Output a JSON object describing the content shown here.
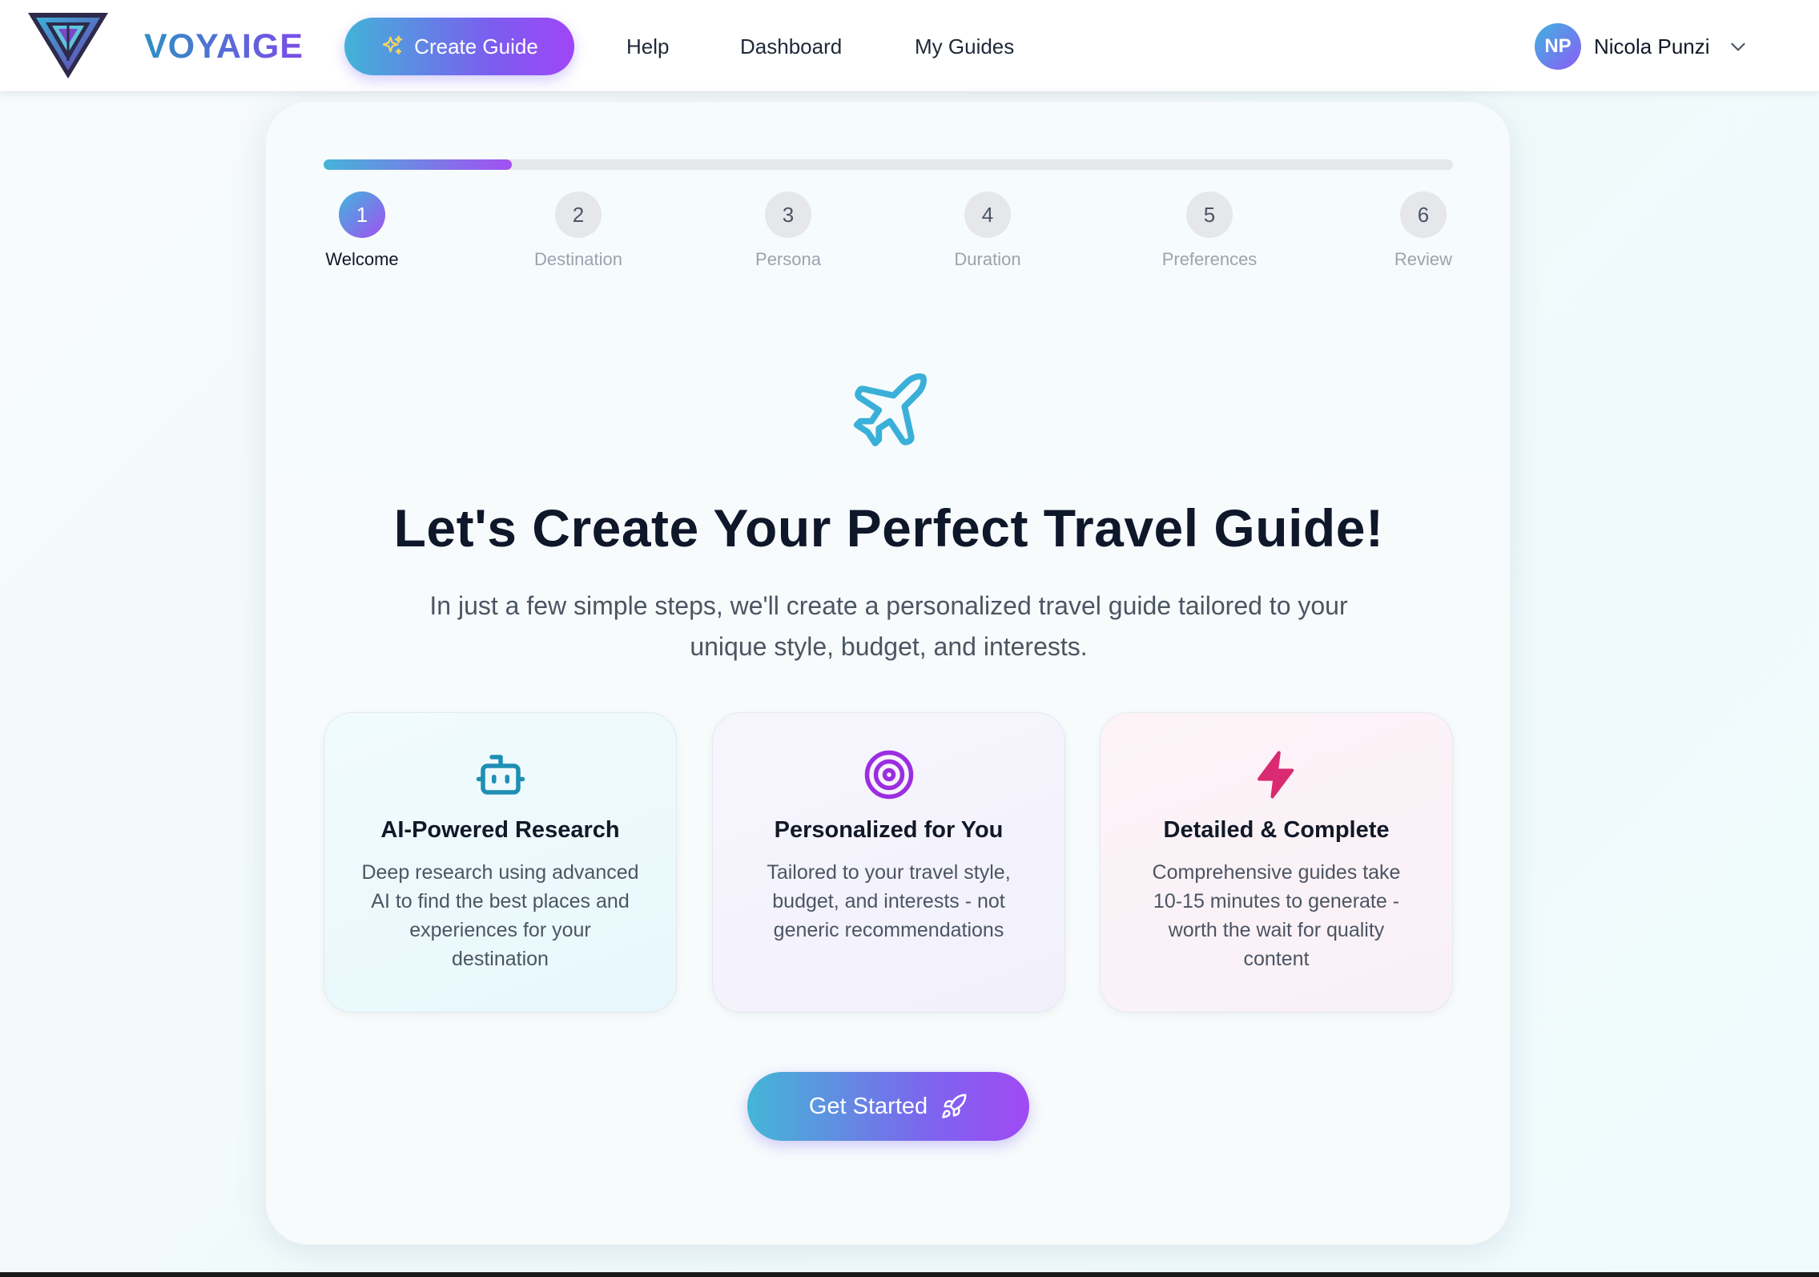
{
  "navbar": {
    "brand": "VOYAIGE",
    "create_guide": "Create Guide",
    "links": {
      "help": "Help",
      "dashboard": "Dashboard",
      "my_guides": "My Guides"
    },
    "user": {
      "initials": "NP",
      "name": "Nicola Punzi"
    }
  },
  "wizard": {
    "progress": {
      "current_step": 1,
      "total_steps": 6,
      "fraction": 0.167
    },
    "steps": [
      {
        "number": "1",
        "label": "Welcome",
        "active": true
      },
      {
        "number": "2",
        "label": "Destination",
        "active": false
      },
      {
        "number": "3",
        "label": "Persona",
        "active": false
      },
      {
        "number": "4",
        "label": "Duration",
        "active": false
      },
      {
        "number": "5",
        "label": "Preferences",
        "active": false
      },
      {
        "number": "6",
        "label": "Review",
        "active": false
      }
    ]
  },
  "hero": {
    "title": "Let's Create Your Perfect Travel Guide!",
    "subtitle": "In just a few simple steps, we'll create a personalized travel guide tailored to your unique style, budget, and interests."
  },
  "features": [
    {
      "icon": "robot-icon",
      "title": "AI-Powered Research",
      "description": "Deep research using advanced AI to find the best places and experiences for your destination"
    },
    {
      "icon": "target-icon",
      "title": "Personalized for You",
      "description": "Tailored to your travel style, budget, and interests - not generic recommendations"
    },
    {
      "icon": "lightning-icon",
      "title": "Detailed & Complete",
      "description": "Comprehensive guides take 10-15 minutes to generate - worth the wait for quality content"
    }
  ],
  "cta": {
    "label": "Get Started",
    "icon": "rocket-icon"
  },
  "colors": {
    "accent_start": "#42b3d8",
    "accent_end": "#a046f6",
    "robot_icon": "#1f8fb3",
    "target_icon": "#9b2ee0",
    "lightning_icon": "#d92a72",
    "plane_icon": "#3ab0d8"
  }
}
